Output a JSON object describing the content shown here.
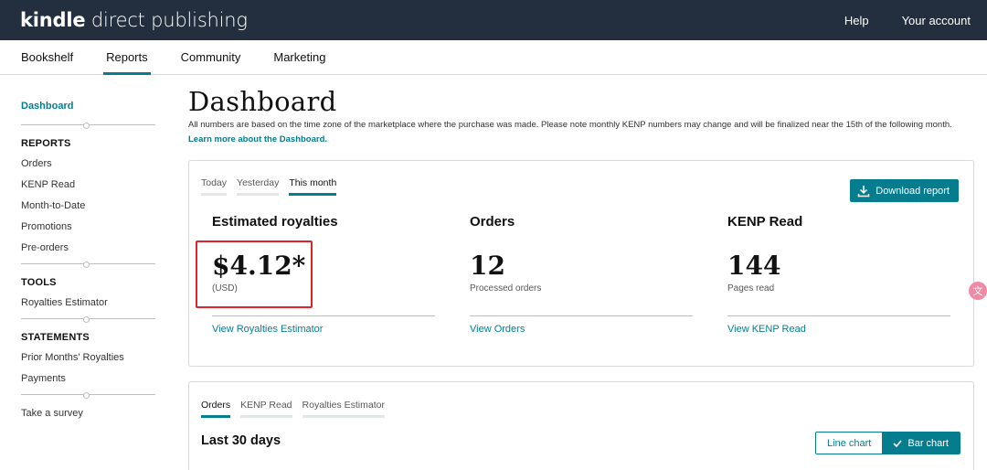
{
  "header": {
    "logo_bold": "kindle",
    "logo_light": " direct publishing",
    "help": "Help",
    "account": "Your account"
  },
  "tabs": [
    "Bookshelf",
    "Reports",
    "Community",
    "Marketing"
  ],
  "sidebar": {
    "dashboard": "Dashboard",
    "reports_head": "REPORTS",
    "reports": [
      "Orders",
      "KENP Read",
      "Month-to-Date",
      "Promotions",
      "Pre-orders"
    ],
    "tools_head": "TOOLS",
    "tools": [
      "Royalties Estimator"
    ],
    "statements_head": "STATEMENTS",
    "statements": [
      "Prior Months' Royalties",
      "Payments"
    ],
    "survey": "Take a survey"
  },
  "main": {
    "title": "Dashboard",
    "subtitle": "All numbers are based on the time zone of the marketplace where the purchase was made. Please note monthly KENP numbers may change and will be finalized near the 15th of the following month.",
    "subtitle_link": "Learn more about the Dashboard."
  },
  "summary_card": {
    "tabs": [
      "Today",
      "Yesterday",
      "This month"
    ],
    "download": "Download report",
    "metrics": [
      {
        "title": "Estimated royalties",
        "value": "$4.12*",
        "caption": "(USD)",
        "link": "View Royalties Estimator"
      },
      {
        "title": "Orders",
        "value": "12",
        "caption": "Processed orders",
        "link": "View Orders"
      },
      {
        "title": "KENP Read",
        "value": "144",
        "caption": "Pages read",
        "link": "View KENP Read"
      }
    ]
  },
  "chart_card": {
    "tabs": [
      "Orders",
      "KENP Read",
      "Royalties Estimator"
    ],
    "heading": "Last 30 days",
    "line_chart": "Line chart",
    "bar_chart": "Bar chart"
  },
  "colors": {
    "accent": "#067d8f",
    "topbar": "#232f3e",
    "highlight": "#e0242b"
  }
}
